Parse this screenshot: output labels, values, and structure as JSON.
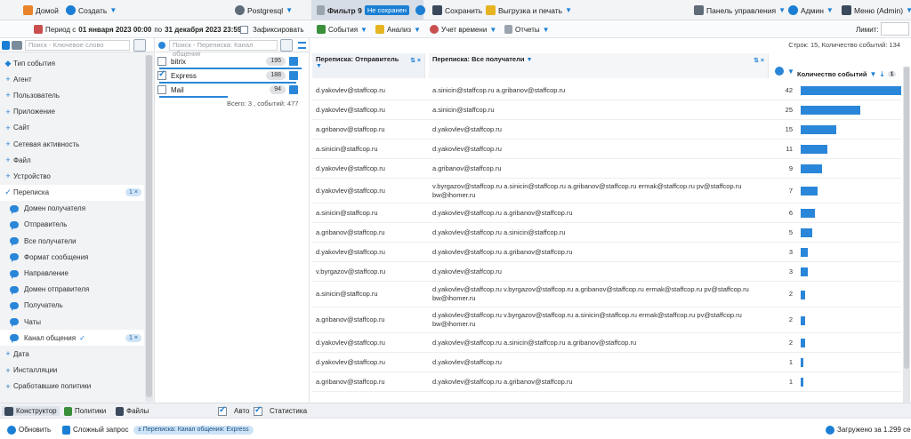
{
  "topbar": {
    "home": "Домой",
    "create": "Создать",
    "db": "Postgresql",
    "tab_title": "Фильтр 9",
    "tab_status": "Не сохранен",
    "save": "Сохранить",
    "export": "Выгрузка и печать",
    "dashboard": "Панель управления",
    "admin": "Админ",
    "menu": "Меню (Admin)"
  },
  "toolbar2": {
    "period_prefix": "Период с ",
    "period_from": "01 января 2023 00:00",
    "period_mid": " по ",
    "period_to": "31 декабря 2023 23:59",
    "fix_label": "Зафиксировать",
    "events": "События",
    "analysis": "Анализ",
    "time": "Учет времени",
    "reports": "Отчеты",
    "limit_label": "Лимит:"
  },
  "left_panel": {
    "search_placeholder": "Поиск - Ключевое слово",
    "items": [
      {
        "label": "Тип события",
        "kind": "root"
      },
      {
        "label": "Агент",
        "kind": "plus"
      },
      {
        "label": "Пользователь",
        "kind": "plus"
      },
      {
        "label": "Приложение",
        "kind": "plus"
      },
      {
        "label": "Сайт",
        "kind": "plus"
      },
      {
        "label": "Сетевая активность",
        "kind": "plus"
      },
      {
        "label": "Файл",
        "kind": "plus"
      },
      {
        "label": "Устройство",
        "kind": "plus"
      },
      {
        "label": "Переписка",
        "kind": "open",
        "badge": "1"
      },
      {
        "label": "Домен получателя",
        "kind": "sub"
      },
      {
        "label": "Отправитель",
        "kind": "sub"
      },
      {
        "label": "Все получатели",
        "kind": "sub"
      },
      {
        "label": "Формат сообщения",
        "kind": "sub"
      },
      {
        "label": "Направление",
        "kind": "sub"
      },
      {
        "label": "Домен отправителя",
        "kind": "sub"
      },
      {
        "label": "Получатель",
        "kind": "sub"
      },
      {
        "label": "Чаты",
        "kind": "sub"
      },
      {
        "label": "Канал общения",
        "kind": "sub-sel",
        "badge": "1"
      },
      {
        "label": "Дата",
        "kind": "plus"
      },
      {
        "label": "Инсталляции",
        "kind": "plus"
      },
      {
        "label": "Сработавшие политики",
        "kind": "plus"
      }
    ]
  },
  "mid_panel": {
    "search_placeholder": "Поиск - Переписка: Канал общения",
    "channels": [
      {
        "label": "bitrix",
        "count": "195",
        "checked": false,
        "fill": 1.0
      },
      {
        "label": "Express",
        "count": "188",
        "checked": true,
        "fill": 0.96
      },
      {
        "label": "Mail",
        "count": "94",
        "checked": false,
        "fill": 0.48
      }
    ],
    "total": "Всего: 3 , событий: 477"
  },
  "table": {
    "row_count": "Строк: 15, Количество событий: 134",
    "col_sender": "Переписка: Отправитель",
    "col_recipients": "Переписка: Все получатели",
    "col_events": "Количество событий",
    "col_events_badge": "1",
    "max_value": 42,
    "rows": [
      {
        "sender": "d.yakovlev@staffcop.ru",
        "recipients": "a.sinicin@staffcop.ru a.gribanov@staffcop.ru",
        "count": 42
      },
      {
        "sender": "d.yakovlev@staffcop.ru",
        "recipients": "a.sinicin@staffcop.ru",
        "count": 25
      },
      {
        "sender": "a.gribanov@staffcop.ru",
        "recipients": "d.yakovlev@staffcop.ru",
        "count": 15
      },
      {
        "sender": "a.sinicin@staffcop.ru",
        "recipients": "d.yakovlev@staffcop.ru",
        "count": 11
      },
      {
        "sender": "d.yakovlev@staffcop.ru",
        "recipients": "a.gribanov@staffcop.ru",
        "count": 9
      },
      {
        "sender": "d.yakovlev@staffcop.ru",
        "recipients": "v.byrgazov@staffcop.ru a.sinicin@staffcop.ru a.gribanov@staffcop.ru ermak@staffcop.ru pv@staffcop.ru bw@ihomer.ru",
        "count": 7
      },
      {
        "sender": "a.sinicin@staffcop.ru",
        "recipients": "d.yakovlev@staffcop.ru a.gribanov@staffcop.ru",
        "count": 6
      },
      {
        "sender": "a.gribanov@staffcop.ru",
        "recipients": "d.yakovlev@staffcop.ru a.sinicin@staffcop.ru",
        "count": 5
      },
      {
        "sender": "d.yakovlev@staffcop.ru",
        "recipients": "d.yakovlev@staffcop.ru a.gribanov@staffcop.ru",
        "count": 3
      },
      {
        "sender": "v.byrgazov@staffcop.ru",
        "recipients": "d.yakovlev@staffcop.ru",
        "count": 3
      },
      {
        "sender": "a.sinicin@staffcop.ru",
        "recipients": "d.yakovlev@staffcop.ru v.byrgazov@staffcop.ru a.gribanov@staffcop.ru ermak@staffcop.ru pv@staffcop.ru bw@ihomer.ru",
        "count": 2
      },
      {
        "sender": "a.gribanov@staffcop.ru",
        "recipients": "d.yakovlev@staffcop.ru v.byrgazov@staffcop.ru a.sinicin@staffcop.ru ermak@staffcop.ru pv@staffcop.ru bw@ihomer.ru",
        "count": 2
      },
      {
        "sender": "d.yakovlev@staffcop.ru",
        "recipients": "d.yakovlev@staffcop.ru a.sinicin@staffcop.ru a.gribanov@staffcop.ru",
        "count": 2
      },
      {
        "sender": "d.yakovlev@staffcop.ru",
        "recipients": "d.yakovlev@staffcop.ru",
        "count": 1
      },
      {
        "sender": "a.gribanov@staffcop.ru",
        "recipients": "d.yakovlev@staffcop.ru a.gribanov@staffcop.ru",
        "count": 1
      }
    ]
  },
  "bottom_tabs": {
    "constructor": "Конструктор",
    "policies": "Политики",
    "files": "Файлы",
    "auto": "Авто",
    "stats": "Статистика"
  },
  "statusbar": {
    "refresh": "Обновить",
    "complex": "Сложный запрос",
    "chip": "± Переписка: Канал общения: Express",
    "loaded": "Загружено за 1.299 сек"
  },
  "colors": {
    "accent": "#2a86d8",
    "panel_bg": "#f2f3f5"
  }
}
